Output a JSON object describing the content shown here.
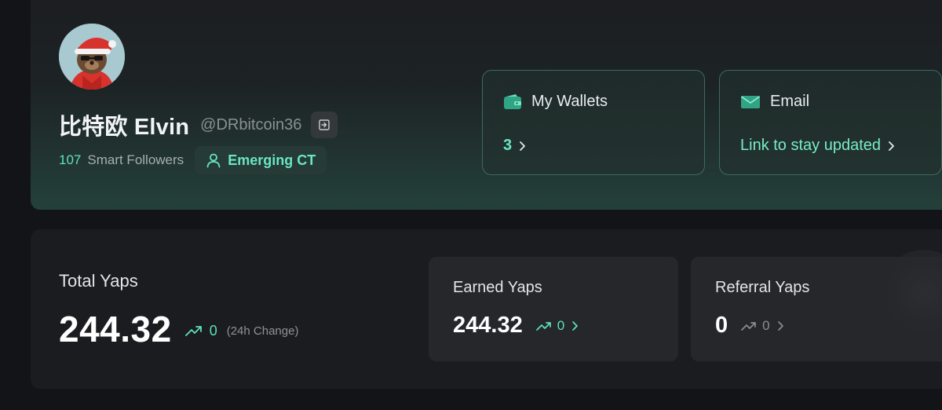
{
  "profile": {
    "display_name": "比特欧 Elvin",
    "handle": "@DRbitcoin36",
    "smart_followers_count": "107",
    "smart_followers_label": "Smart Followers",
    "tier_badge": "Emerging CT"
  },
  "wallets_card": {
    "title": "My Wallets",
    "count": "3"
  },
  "email_card": {
    "title": "Email",
    "link_text": "Link to stay updated"
  },
  "total_yaps": {
    "label": "Total Yaps",
    "value": "244.32",
    "change": "0",
    "change_caption": "(24h Change)"
  },
  "earned_yaps": {
    "label": "Earned Yaps",
    "value": "244.32",
    "change": "0"
  },
  "referral_yaps": {
    "label": "Referral Yaps",
    "value": "0",
    "change": "0"
  },
  "colors": {
    "accent": "#5ee2bd",
    "background": "#131417",
    "card": "#25272b"
  }
}
